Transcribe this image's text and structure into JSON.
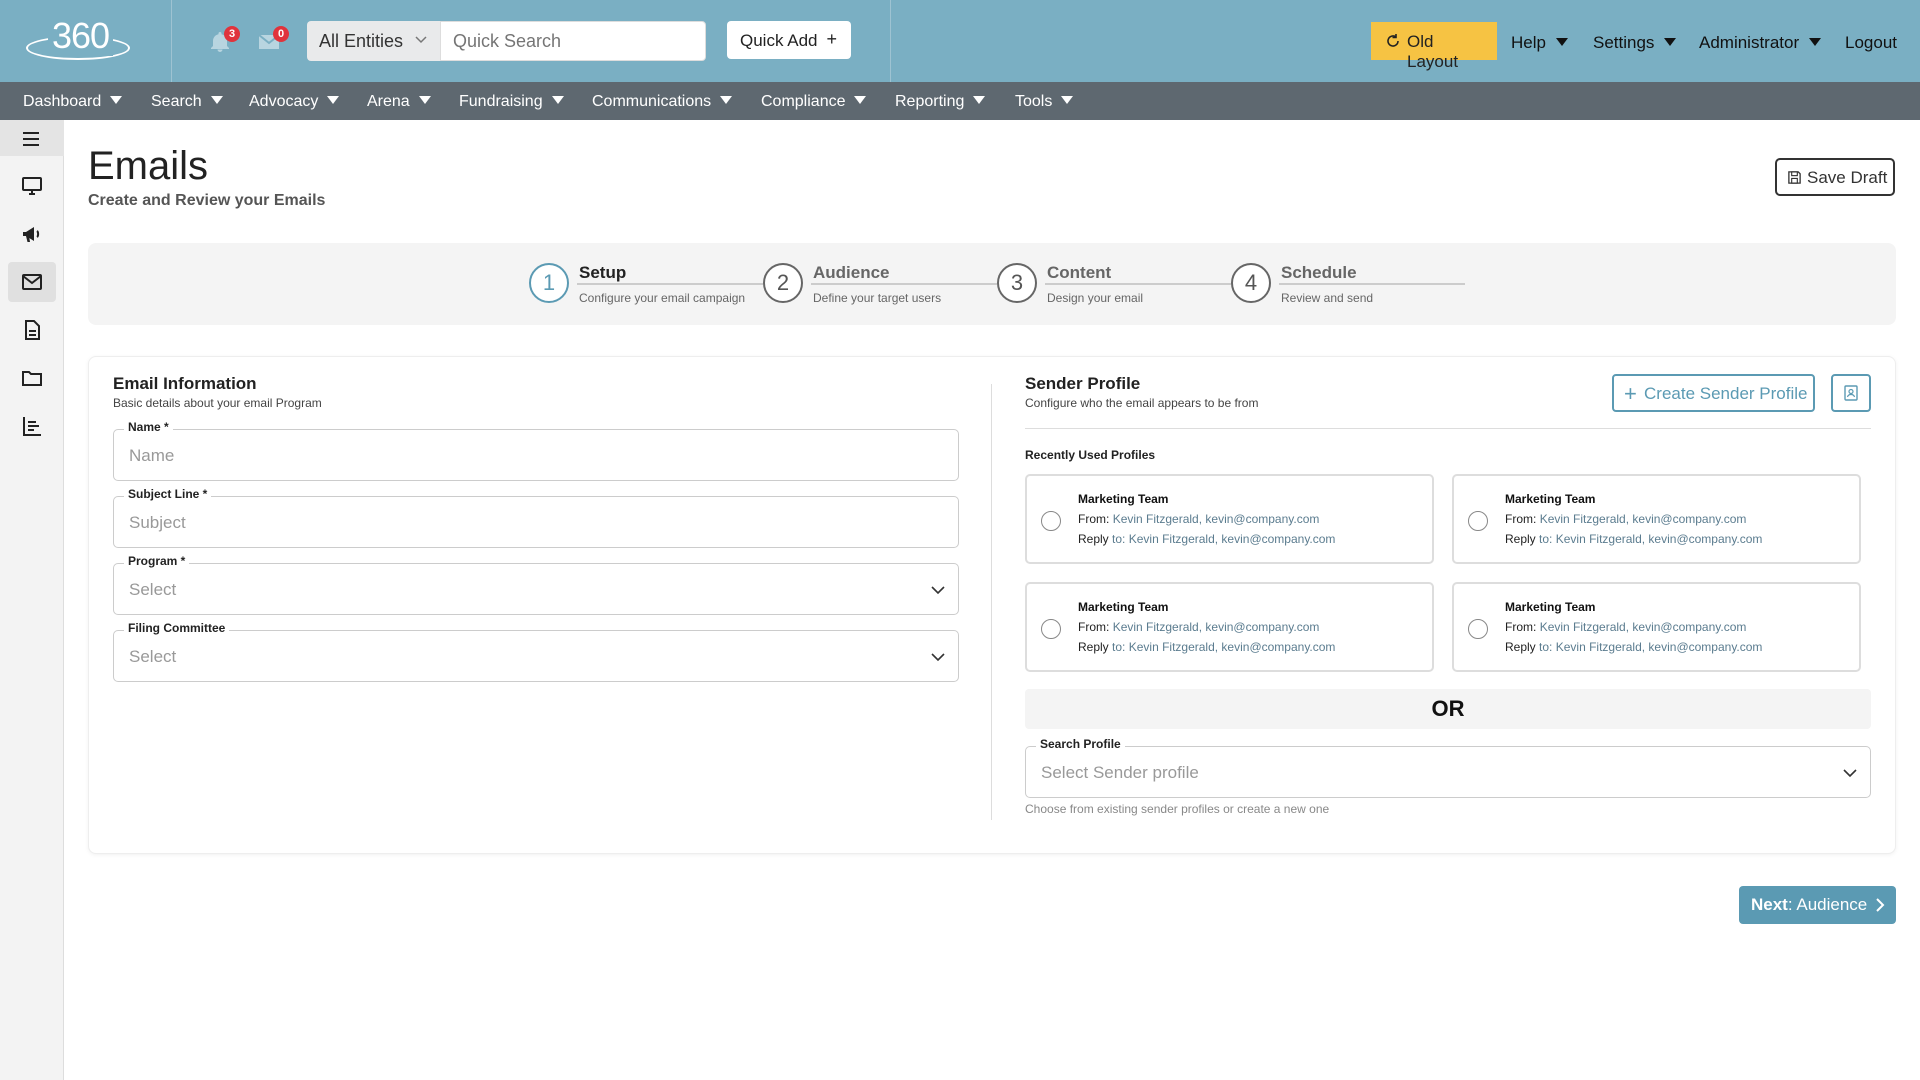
{
  "header": {
    "logo_text": "360",
    "notifications_count": "3",
    "messages_count": "0",
    "entity_select": "All Entities",
    "quick_search_placeholder": "Quick Search",
    "quick_add_label": "Quick Add",
    "old_layout_label": "Old Layout",
    "menus": [
      "Help",
      "Settings",
      "Administrator"
    ],
    "logout_label": "Logout"
  },
  "nav": {
    "items": [
      "Dashboard",
      "Search",
      "Advocacy",
      "Arena",
      "Fundraising",
      "Communications",
      "Compliance",
      "Reporting",
      "Tools"
    ]
  },
  "sidebar": {
    "icons": [
      "menu-icon",
      "monitor-icon",
      "megaphone-icon",
      "mail-icon",
      "document-icon",
      "folder-icon",
      "chart-icon"
    ]
  },
  "page": {
    "title": "Emails",
    "subtitle": "Create and Review your Emails",
    "save_draft_label": "Save Draft"
  },
  "stepper": {
    "steps": [
      {
        "number": "1",
        "title": "Setup",
        "desc": "Configure your email campaign"
      },
      {
        "number": "2",
        "title": "Audience",
        "desc": "Define your target users"
      },
      {
        "number": "3",
        "title": "Content",
        "desc": "Design your email"
      },
      {
        "number": "4",
        "title": "Schedule",
        "desc": "Review and send"
      }
    ]
  },
  "email_info": {
    "title": "Email Information",
    "desc": "Basic details about your email Program",
    "fields": [
      {
        "label": "Name *",
        "placeholder": "Name"
      },
      {
        "label": "Subject Line *",
        "placeholder": "Subject"
      },
      {
        "label": "Program *",
        "placeholder": "Select"
      },
      {
        "label": "Filing Committee",
        "placeholder": "Select"
      }
    ]
  },
  "sender_profile": {
    "title": "Sender Profile",
    "desc": "Configure who the email appears to be from",
    "create_label": "Create Sender Profile",
    "recent_label": "Recently Used Profiles",
    "from_label": "From:",
    "reply_label": "Reply",
    "reply_to_label": "to:",
    "profiles": [
      {
        "name": "Marketing Team",
        "from": "Kevin Fitzgerald, kevin@company.com",
        "reply": "Kevin Fitzgerald, kevin@company.com"
      },
      {
        "name": "Marketing Team",
        "from": "Kevin Fitzgerald, kevin@company.com",
        "reply": "Kevin Fitzgerald, kevin@company.com"
      },
      {
        "name": "Marketing Team",
        "from": "Kevin Fitzgerald, kevin@company.com",
        "reply": "Kevin Fitzgerald, kevin@company.com"
      },
      {
        "name": "Marketing Team",
        "from": "Kevin Fitzgerald, kevin@company.com",
        "reply": "Kevin Fitzgerald, kevin@company.com"
      }
    ],
    "or_label": "OR",
    "search_label": "Search Profile",
    "search_placeholder": "Select Sender profile",
    "help_text": "Choose from existing sender profiles or create a new one"
  },
  "footer": {
    "next_bold": "Next",
    "next_rest": ": Audience"
  },
  "colors": {
    "topbar": "#7aafc3",
    "navbar": "#5e6870",
    "accent": "#5b9ab3",
    "old_layout": "#f6c343",
    "badge": "#e0333c"
  }
}
